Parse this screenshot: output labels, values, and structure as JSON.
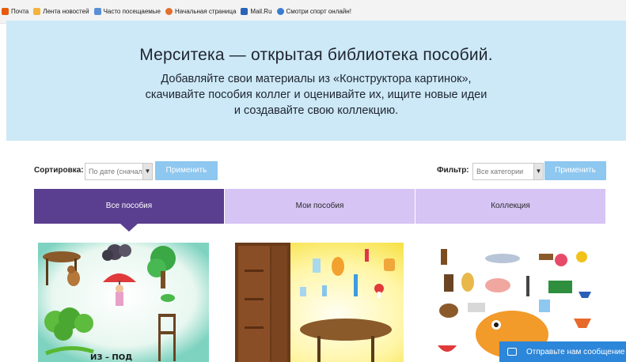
{
  "bookmarks": [
    {
      "label": "Почта",
      "icon": "mail-icon"
    },
    {
      "label": "Лента новостей",
      "icon": "news-feed-icon"
    },
    {
      "label": "Часто посещаемые",
      "icon": "frequent-icon"
    },
    {
      "label": "Начальная страница",
      "icon": "home-icon"
    },
    {
      "label": "Mail.Ru",
      "icon": "mailru-icon"
    },
    {
      "label": "Смотри спорт онлайн!",
      "icon": "sport-icon"
    }
  ],
  "hero": {
    "title": "Мерситека — открытая библиотека пособий.",
    "lines": [
      "Добавляйте свои материалы из «Конструктора картинок»,",
      "скачивайте пособия коллег и оценивайте их, ищите новые идеи",
      "и создавайте свою коллекцию."
    ]
  },
  "sort": {
    "label": "Сортировка:",
    "value": "По дате (сначала",
    "apply": "Применить"
  },
  "filter": {
    "label": "Фильтр:",
    "value": "Все категории",
    "apply": "Применить"
  },
  "tabs": [
    {
      "label": "Все пособия",
      "active": true
    },
    {
      "label": "Мои пособия",
      "active": false
    },
    {
      "label": "Коллекция",
      "active": false
    }
  ],
  "cards": [
    {
      "caption": "ИЗ – ПОД"
    },
    {
      "caption": ""
    },
    {
      "caption": ""
    }
  ],
  "chat": {
    "label": "Отправьте нам сообщение"
  },
  "colors": {
    "hero_bg": "#cde9f7",
    "tab_active": "#5a3e8f",
    "tab_inactive": "#d6c4f5",
    "button": "#8ec7ef",
    "chat": "#2c86d9"
  }
}
